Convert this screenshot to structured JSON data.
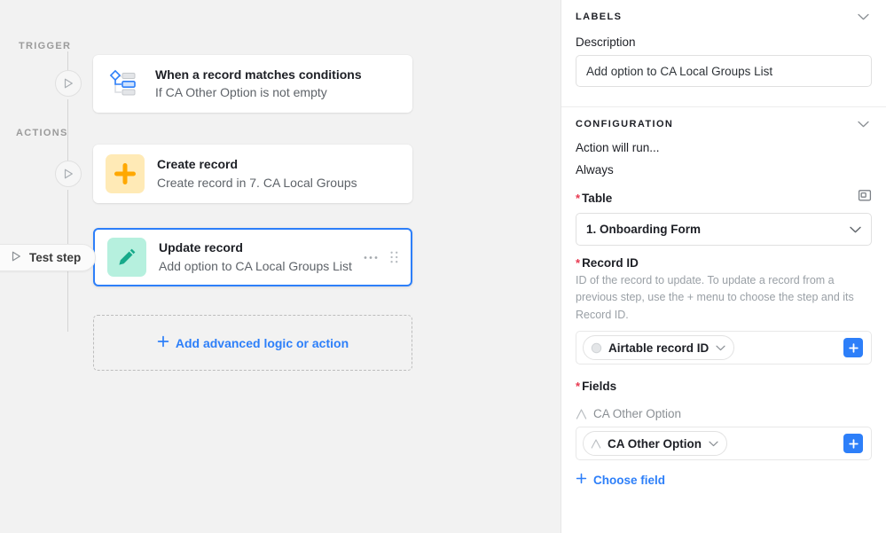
{
  "flow": {
    "trigger_section_label": "TRIGGER",
    "actions_section_label": "ACTIONS",
    "test_step_label": "Test step",
    "steps": [
      {
        "title": "When a record matches conditions",
        "subtitle": "If CA Other Option is not empty",
        "icon": "branch-conditions-icon",
        "selected": false
      },
      {
        "title": "Create record",
        "subtitle": "Create record in 7. CA Local Groups",
        "icon": "plus-icon",
        "selected": false
      },
      {
        "title": "Update record",
        "subtitle": "Add option to CA Local Groups List",
        "icon": "pencil-icon",
        "selected": true
      }
    ],
    "add_action_label": "Add advanced logic or action"
  },
  "panel": {
    "labels_section": {
      "title": "LABELS",
      "description_label": "Description",
      "description_value": "Add option to CA Local Groups List"
    },
    "configuration_section": {
      "title": "CONFIGURATION",
      "action_will_run_label": "Action will run...",
      "action_will_run_value": "Always",
      "table_label": "Table",
      "table_value": "1. Onboarding Form",
      "record_id_label": "Record ID",
      "record_id_help": "ID of the record to update. To update a record from a previous step, use the + menu to choose the step and its Record ID.",
      "record_id_token": "Airtable record ID",
      "fields_label": "Fields",
      "field_name": "CA Other Option",
      "field_token": "CA Other Option",
      "choose_field_label": "Choose field"
    }
  },
  "colors": {
    "accent_blue": "#2d7ff9",
    "required_red": "#e8384f",
    "create_icon_bg": "#ffeab6",
    "create_icon_fg": "#ffa800",
    "update_icon_bg": "#b6f0de",
    "update_icon_fg": "#17a98a",
    "canvas_bg": "#f2f2f2"
  }
}
